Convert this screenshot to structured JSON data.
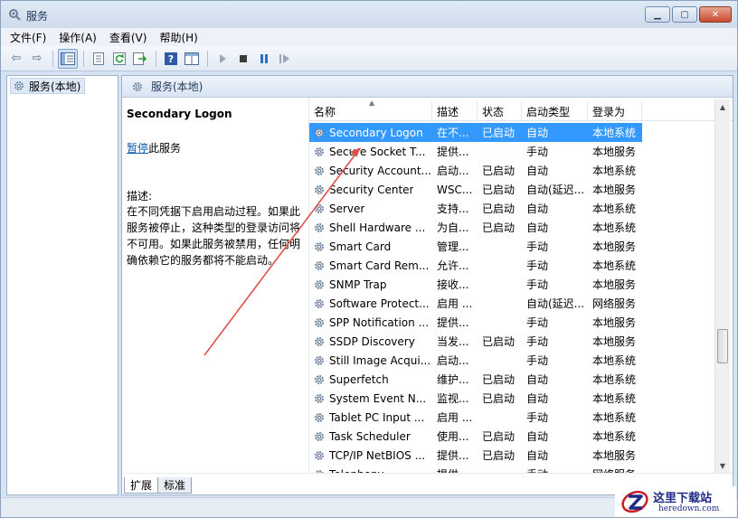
{
  "window": {
    "title": "服务"
  },
  "menu": [
    "文件(F)",
    "操作(A)",
    "查看(V)",
    "帮助(H)"
  ],
  "toolbar_icons": [
    "back-arrow-icon",
    "forward-arrow-icon",
    "show-hide-tree-icon",
    "properties-icon",
    "refresh-icon",
    "export-list-icon",
    "help-icon",
    "show-hide-action-pane-icon",
    "start-service-icon",
    "stop-service-icon",
    "pause-service-icon",
    "restart-service-icon"
  ],
  "tree": {
    "root_label": "服务(本地)"
  },
  "pane": {
    "header": "服务(本地)",
    "selected_name": "Secondary Logon",
    "action_link": "暂停",
    "action_suffix": "此服务",
    "desc_label": "描述:",
    "desc_text": "在不同凭据下启用启动过程。如果此服务被停止，这种类型的登录访问将不可用。如果此服务被禁用，任何明确依赖它的服务都将不能启动。"
  },
  "columns": {
    "name": "名称",
    "desc": "描述",
    "state": "状态",
    "start_type": "启动类型",
    "logon": "登录为"
  },
  "services": [
    {
      "name": "Secondary Logon",
      "desc": "在不...",
      "state": "已启动",
      "start": "自动",
      "logon": "本地系统",
      "selected": true
    },
    {
      "name": "Secure Socket T...",
      "desc": "提供...",
      "state": "",
      "start": "手动",
      "logon": "本地服务"
    },
    {
      "name": "Security Account...",
      "desc": "启动...",
      "state": "已启动",
      "start": "自动",
      "logon": "本地系统"
    },
    {
      "name": "Security Center",
      "desc": "WSC...",
      "state": "已启动",
      "start": "自动(延迟...",
      "logon": "本地服务"
    },
    {
      "name": "Server",
      "desc": "支持...",
      "state": "已启动",
      "start": "自动",
      "logon": "本地系统"
    },
    {
      "name": "Shell Hardware ...",
      "desc": "为自...",
      "state": "已启动",
      "start": "自动",
      "logon": "本地系统"
    },
    {
      "name": "Smart Card",
      "desc": "管理...",
      "state": "",
      "start": "手动",
      "logon": "本地服务"
    },
    {
      "name": "Smart Card Rem...",
      "desc": "允许...",
      "state": "",
      "start": "手动",
      "logon": "本地系统"
    },
    {
      "name": "SNMP Trap",
      "desc": "接收...",
      "state": "",
      "start": "手动",
      "logon": "本地服务"
    },
    {
      "name": "Software Protect...",
      "desc": "启用 ...",
      "state": "",
      "start": "自动(延迟...",
      "logon": "网络服务"
    },
    {
      "name": "SPP Notification ...",
      "desc": "提供...",
      "state": "",
      "start": "手动",
      "logon": "本地服务"
    },
    {
      "name": "SSDP Discovery",
      "desc": "当发...",
      "state": "已启动",
      "start": "手动",
      "logon": "本地服务"
    },
    {
      "name": "Still Image Acqui...",
      "desc": "启动...",
      "state": "",
      "start": "手动",
      "logon": "本地系统"
    },
    {
      "name": "Superfetch",
      "desc": "维护...",
      "state": "已启动",
      "start": "自动",
      "logon": "本地系统"
    },
    {
      "name": "System Event N...",
      "desc": "监视...",
      "state": "已启动",
      "start": "自动",
      "logon": "本地系统"
    },
    {
      "name": "Tablet PC Input ...",
      "desc": "启用 ...",
      "state": "",
      "start": "手动",
      "logon": "本地系统"
    },
    {
      "name": "Task Scheduler",
      "desc": "使用...",
      "state": "已启动",
      "start": "自动",
      "logon": "本地系统"
    },
    {
      "name": "TCP/IP NetBIOS ...",
      "desc": "提供...",
      "state": "已启动",
      "start": "自动",
      "logon": "本地服务"
    },
    {
      "name": "Telephony",
      "desc": "提供...",
      "state": "",
      "start": "手动",
      "logon": "网络服务"
    }
  ],
  "tabs": [
    "扩展",
    "标准"
  ],
  "watermark": {
    "cn": "这里下载站",
    "en": "heredown.com"
  },
  "colors": {
    "selection": "#3399ff",
    "annotation_arrow": "#e0504a",
    "link": "#0b5eaf"
  }
}
